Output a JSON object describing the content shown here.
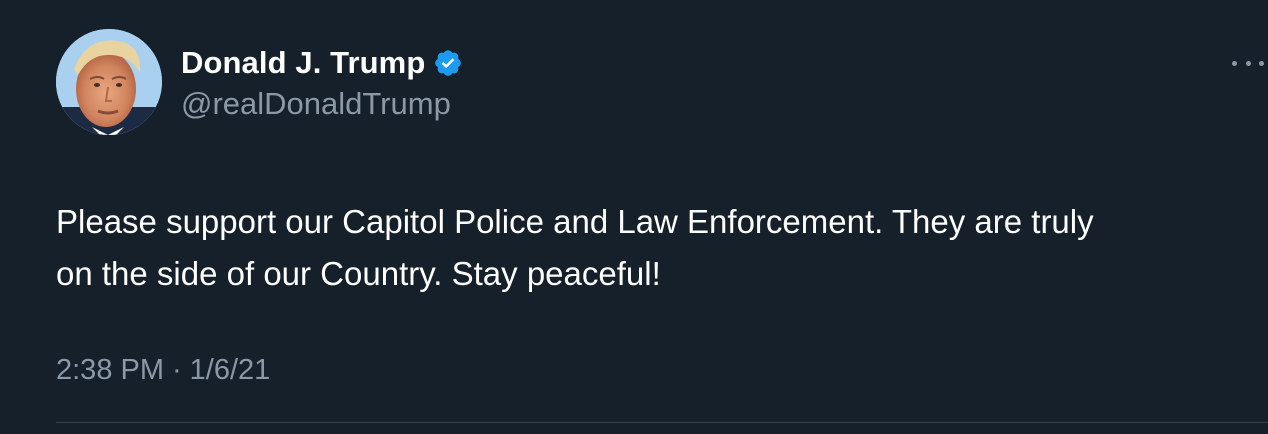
{
  "tweet": {
    "author": {
      "display_name": "Donald J. Trump",
      "handle": "@realDonaldTrump",
      "verified": true
    },
    "text": "Please support our Capitol Police and Law Enforcement. They are truly\non the side of our Country. Stay peaceful!",
    "time": "2:38 PM",
    "separator": "·",
    "date": "1/6/21",
    "more_icon": "more-horizontal-icon"
  },
  "colors": {
    "background": "#15202b",
    "text_primary": "#ffffff",
    "text_secondary": "#8b98a5",
    "verified_badge": "#1d9bf0",
    "divider": "#38444d"
  }
}
